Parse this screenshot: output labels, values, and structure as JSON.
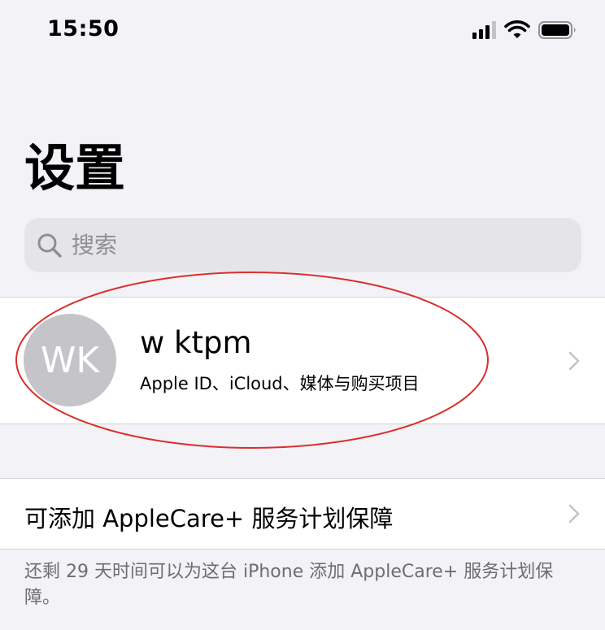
{
  "status_bar": {
    "time": "15:50",
    "icons": [
      "cellular-signal-icon",
      "wifi-icon",
      "battery-icon"
    ]
  },
  "page": {
    "title": "设置"
  },
  "search": {
    "placeholder": "搜索",
    "icon": "search-icon"
  },
  "profile": {
    "initials": "WK",
    "name": "w ktpm",
    "subtitle": "Apple ID、iCloud、媒体与购买项目"
  },
  "applecare": {
    "label": "可添加 AppleCare+ 服务计划保障",
    "note": "还剩 29 天时间可以为这台 iPhone 添加 AppleCare+ 服务计划保障。"
  },
  "colors": {
    "background": "#f2f2f7",
    "cell": "#ffffff",
    "avatar": "#c5c5c9",
    "secondary_text": "#6d6d72",
    "annotation": "#d9302b"
  }
}
